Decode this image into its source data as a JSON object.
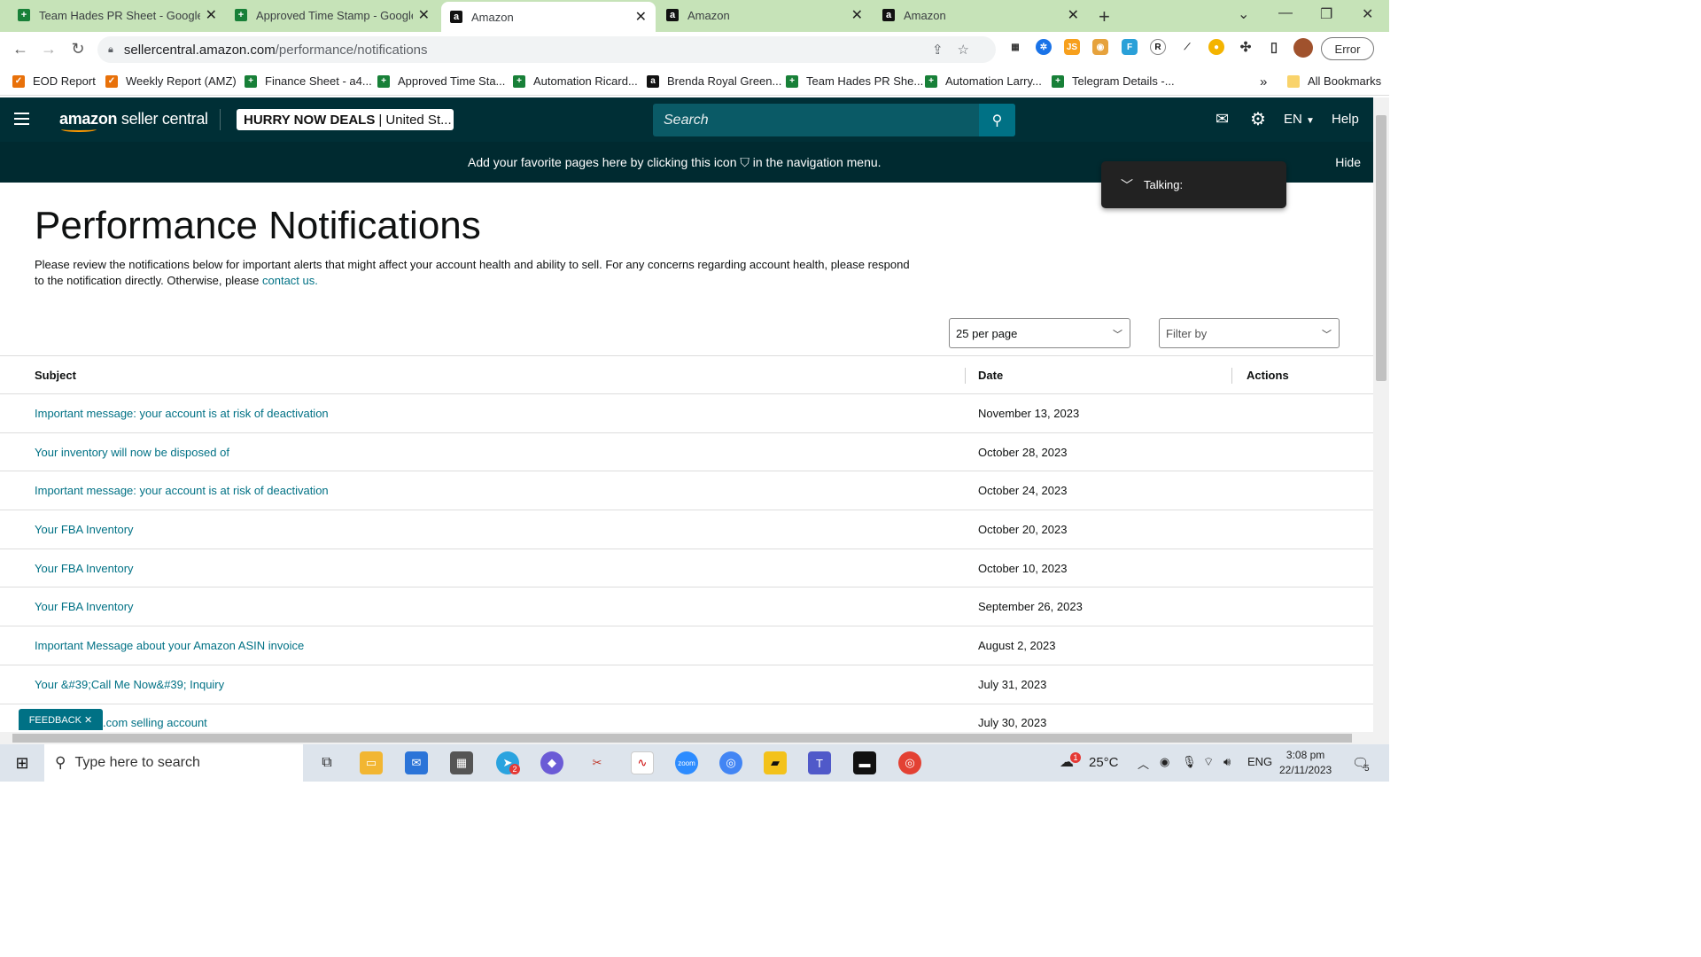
{
  "browser": {
    "tabs": [
      {
        "title": "Team Hades PR Sheet - Google S",
        "icon": "sheets-icon"
      },
      {
        "title": "Approved Time Stamp - Google",
        "icon": "sheets-icon"
      },
      {
        "title": "Amazon",
        "icon": "amazon-icon"
      },
      {
        "title": "Amazon",
        "icon": "amazon-icon"
      },
      {
        "title": "Amazon",
        "icon": "amazon-icon"
      }
    ],
    "url_host": "sellercentral.amazon.com",
    "url_path": "/performance/notifications",
    "profile_button": "Error",
    "bookmarks": [
      "EOD Report",
      "Weekly Report (AMZ)",
      "Finance Sheet - a4...",
      "Approved Time Sta...",
      "Automation Ricard...",
      "Brenda Royal Green...",
      "Team Hades PR She...",
      "Automation Larry...",
      "Telegram Details -..."
    ],
    "more_bookmarks": "»",
    "all_bookmarks": "All Bookmarks"
  },
  "header": {
    "logo_bold": "amazon",
    "logo_rest": " seller central",
    "store_name": "HURRY NOW DEALS",
    "store_region": "| United St...",
    "search_placeholder": "Search",
    "language": "EN",
    "help": "Help"
  },
  "banner": {
    "message": "Add your favorite pages here by clicking this icon ⛉ in the navigation menu.",
    "hide": "Hide"
  },
  "talking_popup": {
    "label": "Talking:"
  },
  "page": {
    "title": "Performance Notifications",
    "intro": "Please review the notifications below for important alerts that might affect your account health and ability to sell. For any concerns regarding account health, please respond to the notification directly. Otherwise, please ",
    "contact_link": "contact us.",
    "per_page": "25 per page",
    "filter_placeholder": "Filter by"
  },
  "table": {
    "headers": {
      "subject": "Subject",
      "date": "Date",
      "actions": "Actions"
    },
    "rows": [
      {
        "subject": "Important message: your account is at risk of deactivation",
        "date": "November 13, 2023"
      },
      {
        "subject": "Your inventory will now be disposed of",
        "date": "October 28, 2023"
      },
      {
        "subject": "Important message: your account is at risk of deactivation",
        "date": "October 24, 2023"
      },
      {
        "subject": "Your FBA Inventory",
        "date": "October 20, 2023"
      },
      {
        "subject": "Your FBA Inventory",
        "date": "October 10, 2023"
      },
      {
        "subject": "Your FBA Inventory",
        "date": "September 26, 2023"
      },
      {
        "subject": "Important Message about your Amazon ASIN invoice",
        "date": "August 2, 2023"
      },
      {
        "subject": "Your &#39;Call Me Now&#39; Inquiry",
        "date": "July 31, 2023"
      },
      {
        "subject": ".com selling account",
        "date": "July 30, 2023"
      }
    ]
  },
  "feedback": "FEEDBACK ✕",
  "taskbar": {
    "search_placeholder": "Type here to search",
    "weather": "25°C",
    "language": "ENG",
    "time": "3:08 pm",
    "date": "22/11/2023",
    "notification_count": "5",
    "badge_telegram": "2",
    "badge_weather": "1"
  }
}
